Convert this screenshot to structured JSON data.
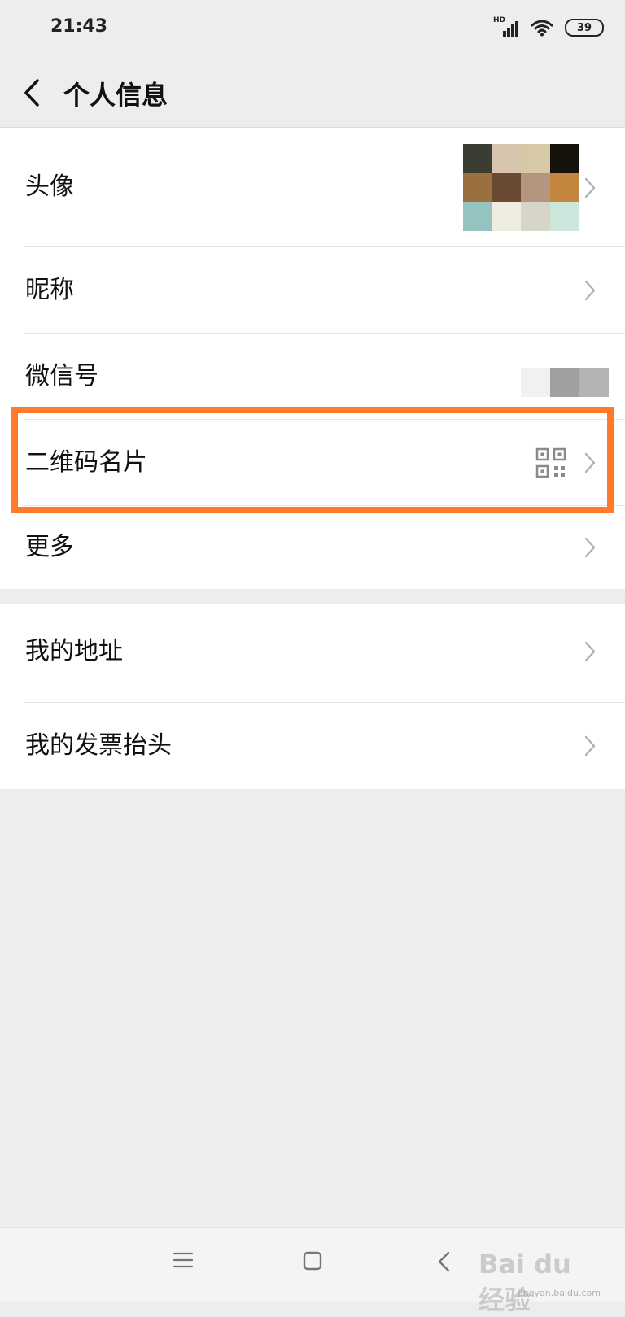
{
  "status_bar": {
    "time": "21:43",
    "network": "HD",
    "battery": "39"
  },
  "header": {
    "title": "个人信息",
    "back_icon": "chevron-left-icon"
  },
  "profile_group": [
    {
      "key": "avatar",
      "label": "头像"
    },
    {
      "key": "nickname",
      "label": "昵称"
    },
    {
      "key": "wechat_id",
      "label": "微信号"
    },
    {
      "key": "qr_code",
      "label": "二维码名片"
    },
    {
      "key": "more",
      "label": "更多"
    }
  ],
  "address_group": [
    {
      "key": "address",
      "label": "我的地址"
    },
    {
      "key": "invoice",
      "label": "我的发票抬头"
    }
  ],
  "avatar_colors": [
    "#3b3d33",
    "#d7c5b0",
    "#d8c9a6",
    "#15110b",
    "#9a703e",
    "#6a4a33",
    "#b39580",
    "#c4863f",
    "#94c3c0",
    "#eeede0",
    "#d6d5c7",
    "#cce6dc"
  ],
  "highlight_color": "#ff7a2a",
  "watermark": {
    "text": "Bai du 经验",
    "url": "jingyan.baidu.com"
  }
}
